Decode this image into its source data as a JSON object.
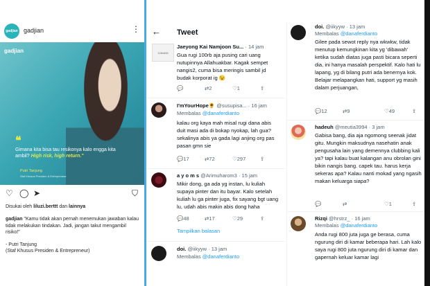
{
  "instagram": {
    "avatar_text": "gadjian",
    "username": "gadjian",
    "more_icon": "more-vertical-icon",
    "post": {
      "brand": "gadjian",
      "quote_mark": "❝",
      "quote_part1": "Gimana kita bisa tau resikonya kalo engga kita ambil? ",
      "quote_part2": "High risk, high return.\"",
      "speaker": "Putri Tanjung",
      "speaker_role": "Staf Khusus Presiden & Entrepreneur"
    },
    "actions": [
      "heart-icon",
      "comment-icon",
      "share-icon",
      "bookmark-icon"
    ],
    "liked_by_prefix": "Disukai oleh ",
    "liked_by_user": "liluzi.berttt",
    "liked_by_mid": " dan ",
    "liked_by_suffix": "lainnya",
    "caption_user": "gadjian",
    "caption_text": " \"Kamu tidak akan pernah menemukan jawaban kalau tidak melakukan tindakan. Jadi, jangan takut mengambil risiko!\"",
    "caption_sign1": "- Putri Tanjung",
    "caption_sign2": "(Staf Khusus Presiden & Entrepreneur)"
  },
  "twitter": {
    "back_icon": "arrow-left-icon",
    "title": "Tweet",
    "col1": [
      {
        "name": "Jaeyong Kai Namjoon Su...",
        "time": "· 14 jam",
        "thumb": "128x600",
        "body": "Gua rugi 100rb aja pusing cari uang nutupinnya Allahuakbar. Kagak sempet nangis2, cuma bisa meringis sambil jd budak korporat ig 😉",
        "replies": "",
        "retweets": "2",
        "likes": "1"
      },
      {
        "name": "I'mYourHope🌻",
        "handle": "@susupisa...",
        "time": "· 16 jam",
        "reply_prefix": "Membalas ",
        "reply_to": "@danaferdianto",
        "body": "kalau org kaya mah misal rugi dana abis duit masi ada di bokap nyokap, lah gua? sekalinya abis ya gada lagi anjing org pas pasan gmn sie",
        "replies": "17",
        "retweets": "72",
        "likes": "297"
      },
      {
        "name": "a y o m s",
        "handle": "@Arimuharom3",
        "time": "· 15 jam",
        "body": "Mikir dong, ga ada yg instan, lu kuliah supaya pinter dan itu bayar. Kalo setelah kuliah lu ga pinter juga, fix sayang bgt uang lu, udah abis makin abis dong haha",
        "replies": "48",
        "retweets": "17",
        "likes": "29",
        "more": "Tampilkan balasan"
      },
      {
        "name": "doi.",
        "handle": "@iikyyw",
        "time": "· 13 jam",
        "reply_prefix": "Membalas ",
        "reply_to": "@danaferdianto"
      }
    ],
    "col2": [
      {
        "name": "doi.",
        "handle": "@iikyyw",
        "time": "· 13 jam",
        "reply_prefix": "Membalas ",
        "reply_to": "@danaferdianto",
        "body": "Gilee pada sewot reply nya wkwkw, tidak menutup kemungkinan kita yg 'dibawah' ketika sudah diatas juga pasti bicara seperti dia, ini hanya masalah perspektif. Kalo hati lu lapang, yg di bilang putri ada benernya kok. Belajar melapangkan hati, support yg masih dalam perjuangan,",
        "replies": "12",
        "retweets": "9",
        "likes": "49"
      },
      {
        "name": "hadeuh",
        "handle": "@meutia3994",
        "time": "· 3 jam",
        "body": "Gabisa bang, dia aja ngomong seenak jidat gitu. Mungkin maksudnya nasehatin anak pengusaha lain yang demennya clubbing kali ya? tapi kalau buat kalangan anu obrolan gini bikin nangis bang. capek tau. harus kerja sekeras apa? Kalau nanti mokad yang ngasih makan keluarga siapa?",
        "replies": "",
        "retweets": "",
        "likes": "1"
      },
      {
        "name": "Rizqi",
        "handle": "@hrstrz_",
        "time": "· 16 jam",
        "reply_prefix": "Membalas ",
        "reply_to": "@danaferdianto",
        "body": "Anda rugi 800 juta juga ge berasa, cuma ngurung diri di kamar beberapa hari. Lah kalo saya rugi 800 juta ngurung diri di kamar dan gapernah keluar kamar lagi"
      }
    ],
    "icons": {
      "reply": "reply-icon",
      "retweet": "retweet-icon",
      "like": "heart-icon",
      "share": "share-icon"
    }
  }
}
